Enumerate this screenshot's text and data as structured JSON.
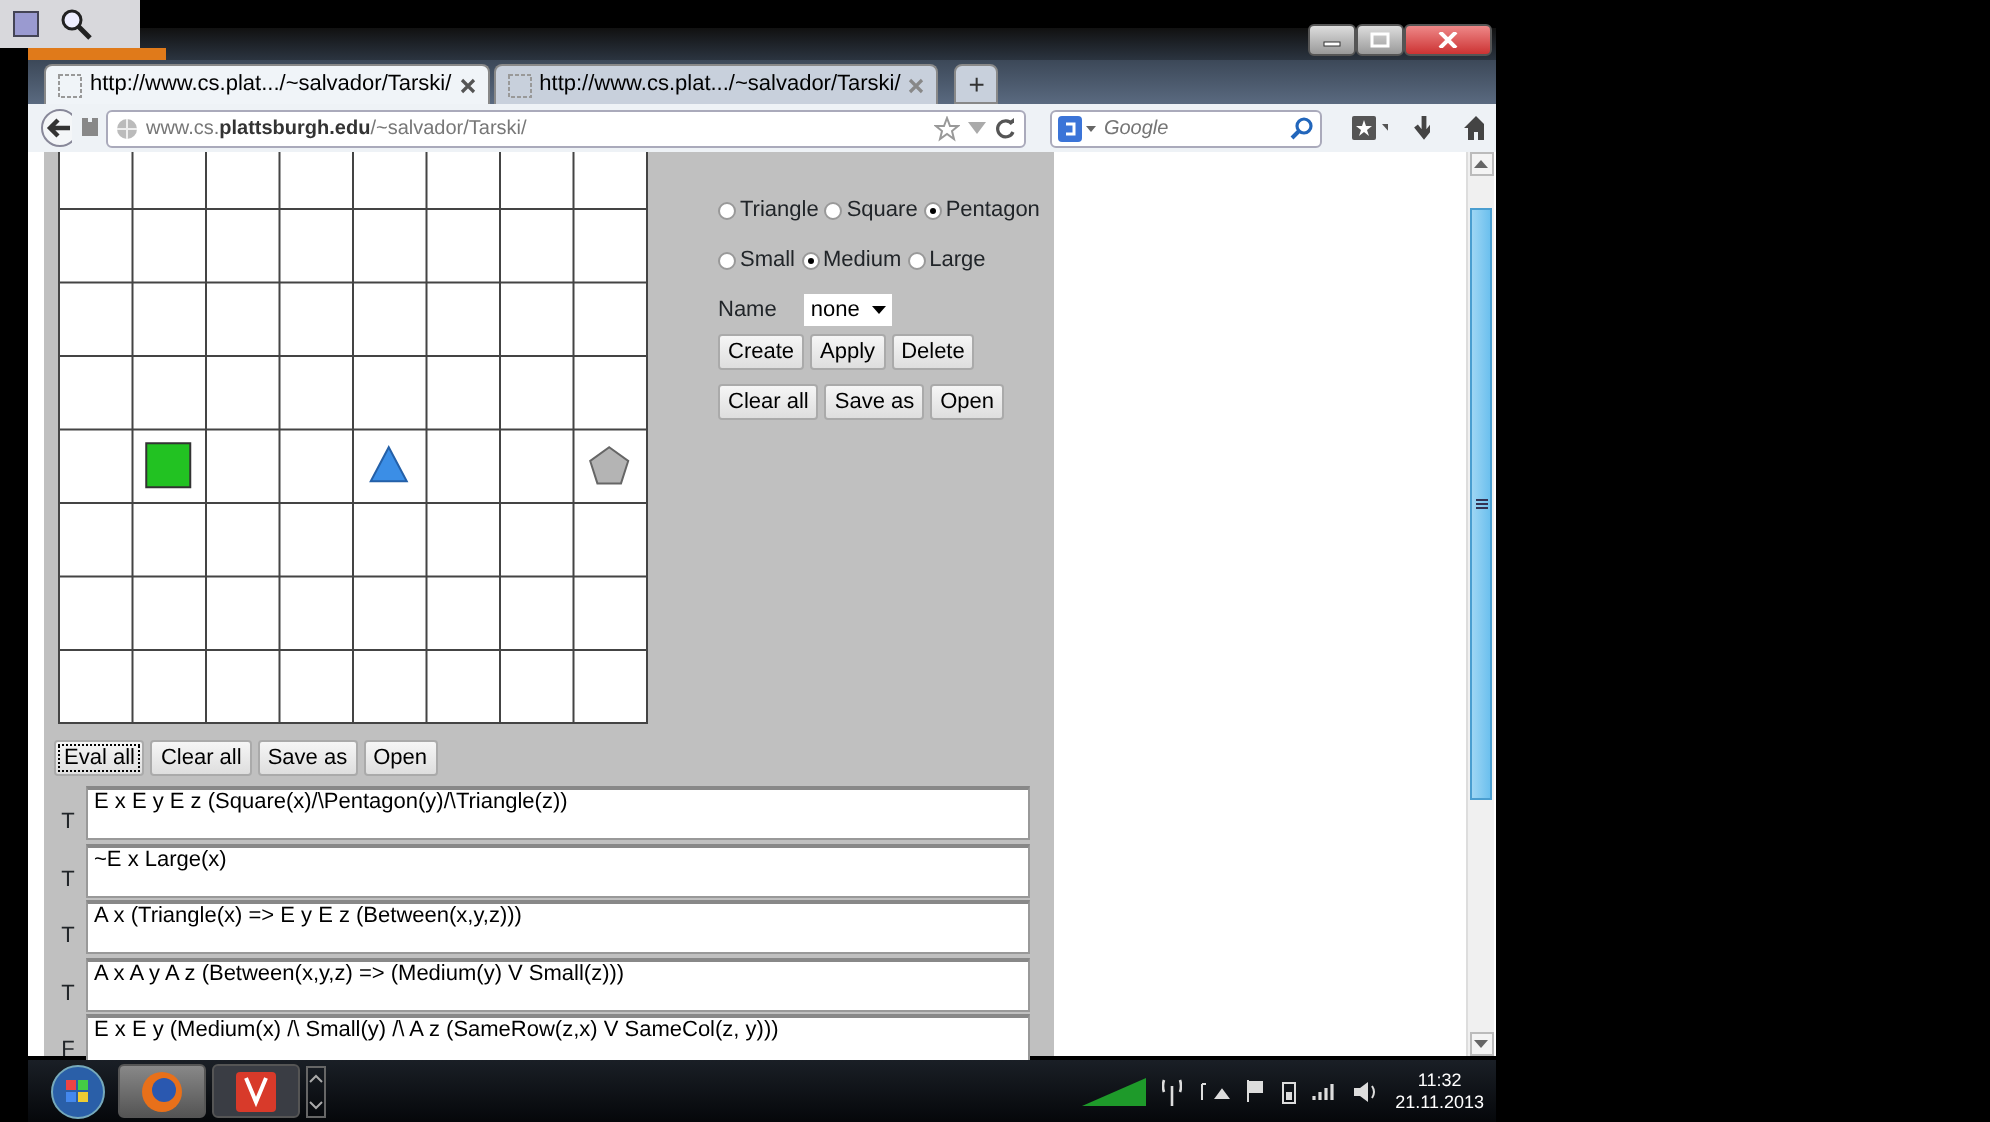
{
  "browser": {
    "tabs": [
      {
        "title": "http://www.cs.plat.../~salvador/Tarski/",
        "selected": true
      },
      {
        "title": "http://www.cs.plat.../~salvador/Tarski/",
        "selected": false
      }
    ],
    "new_tab": "+",
    "address": "www.cs.**plattsburgh.edu**/~salvador/Tarski/",
    "search": {
      "placeholder": "Google"
    }
  },
  "world": {
    "rows": [
      {
        "cells": [
          {
            "kind": "empty"
          },
          {
            "kind": "empty"
          },
          {
            "kind": "empty"
          },
          {
            "kind": "empty"
          },
          {
            "kind": "empty"
          },
          {
            "kind": "empty"
          },
          {
            "kind": "empty"
          },
          {
            "kind": "empty"
          }
        ]
      },
      {
        "cells": [
          {
            "kind": "empty"
          },
          {
            "kind": "empty"
          },
          {
            "kind": "empty"
          },
          {
            "kind": "empty"
          },
          {
            "kind": "empty"
          },
          {
            "kind": "empty"
          },
          {
            "kind": "empty"
          },
          {
            "kind": "empty"
          }
        ]
      },
      {
        "cells": [
          {
            "kind": "empty"
          },
          {
            "kind": "empty"
          },
          {
            "kind": "empty"
          },
          {
            "kind": "empty"
          },
          {
            "kind": "empty"
          },
          {
            "kind": "empty"
          },
          {
            "kind": "empty"
          },
          {
            "kind": "empty"
          }
        ]
      },
      {
        "cells": [
          {
            "kind": "empty"
          },
          {
            "kind": "empty"
          },
          {
            "kind": "empty"
          },
          {
            "kind": "empty"
          },
          {
            "kind": "empty"
          },
          {
            "kind": "empty"
          },
          {
            "kind": "empty"
          },
          {
            "kind": "empty"
          }
        ]
      },
      {
        "cells": [
          {
            "kind": "empty"
          },
          {
            "kind": "square",
            "color": "#22c222"
          },
          {
            "kind": "empty"
          },
          {
            "kind": "empty"
          },
          {
            "kind": "triangle",
            "color": "#3b8ee6"
          },
          {
            "kind": "empty"
          },
          {
            "kind": "empty"
          },
          {
            "kind": "pentagon",
            "color": "#b4b4b4"
          }
        ]
      },
      {
        "cells": [
          {
            "kind": "empty"
          },
          {
            "kind": "empty"
          },
          {
            "kind": "empty"
          },
          {
            "kind": "empty"
          },
          {
            "kind": "empty"
          },
          {
            "kind": "empty"
          },
          {
            "kind": "empty"
          },
          {
            "kind": "empty"
          }
        ]
      },
      {
        "cells": [
          {
            "kind": "empty"
          },
          {
            "kind": "empty"
          },
          {
            "kind": "empty"
          },
          {
            "kind": "empty"
          },
          {
            "kind": "empty"
          },
          {
            "kind": "empty"
          },
          {
            "kind": "empty"
          },
          {
            "kind": "empty"
          }
        ]
      },
      {
        "cells": [
          {
            "kind": "empty"
          },
          {
            "kind": "empty"
          },
          {
            "kind": "empty"
          },
          {
            "kind": "empty"
          },
          {
            "kind": "empty"
          },
          {
            "kind": "empty"
          },
          {
            "kind": "empty"
          },
          {
            "kind": "empty"
          }
        ]
      }
    ]
  },
  "shape_options": [
    {
      "label": "Triangle",
      "selected": false
    },
    {
      "label": "Square",
      "selected": false
    },
    {
      "label": "Pentagon",
      "selected": true
    }
  ],
  "size_options": [
    {
      "label": "Small",
      "selected": false
    },
    {
      "label": "Medium",
      "selected": true
    },
    {
      "label": "Large",
      "selected": false
    }
  ],
  "name_select": {
    "label": "Name",
    "value": "none"
  },
  "object_buttons": [
    "Create",
    "Apply",
    "Delete"
  ],
  "world_buttons": [
    "Clear all",
    "Save as",
    "Open"
  ],
  "sentence_buttons": [
    {
      "label": "Eval all",
      "focused": true
    },
    {
      "label": "Clear all",
      "focused": false
    },
    {
      "label": "Save as",
      "focused": false
    },
    {
      "label": "Open",
      "focused": false
    }
  ],
  "sentences": [
    {
      "value": "T",
      "text": "E x E y E z (Square(x)/\\Pentagon(y)/\\Triangle(z))"
    },
    {
      "value": "T",
      "text": "~E x Large(x)"
    },
    {
      "value": "T",
      "text": "A x (Triangle(x) => E y E z (Between(x,y,z)))"
    },
    {
      "value": "T",
      "text": "A x A y A z (Between(x,y,z) => (Medium(y) V Small(z)))"
    },
    {
      "value": "F",
      "text": "E x E y (Medium(x) /\\ Small(y) /\\ A z (SameRow(z,x) V SameCol(z, y)))"
    }
  ],
  "taskbar": {
    "time": "11:32",
    "date": "21.11.2013"
  }
}
